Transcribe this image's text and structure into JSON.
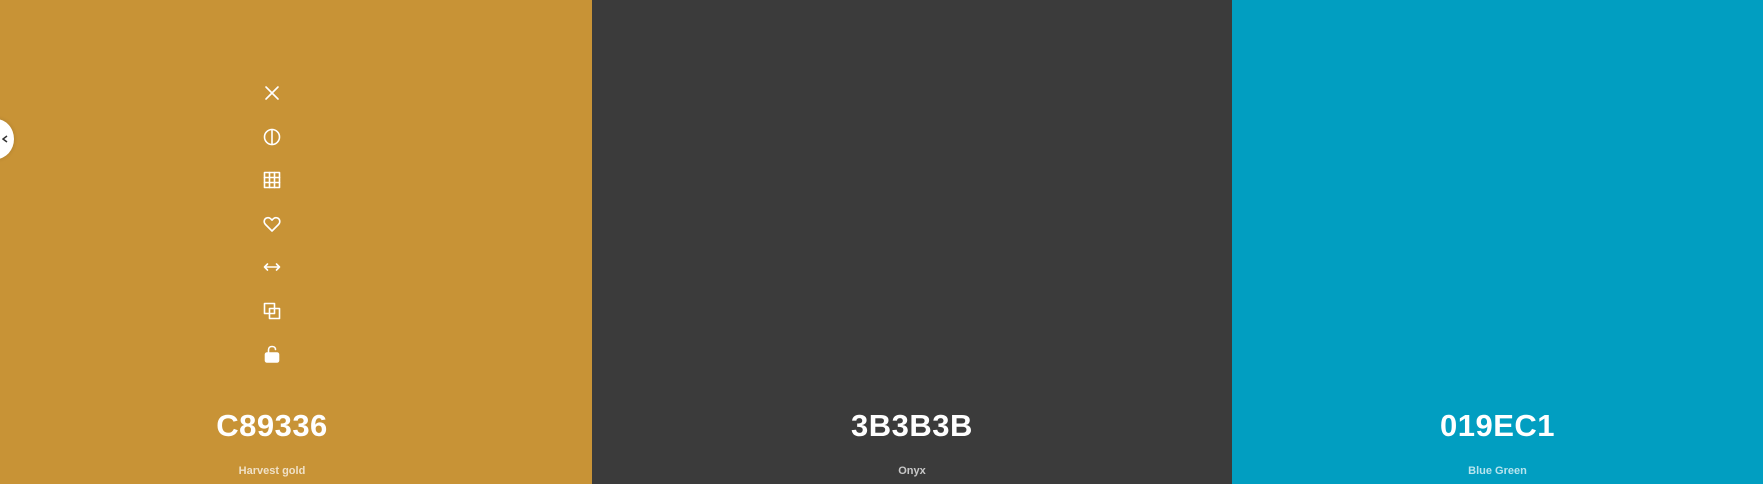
{
  "palette": {
    "colors": [
      {
        "hex": "C89336",
        "name": "Harvest gold",
        "bg": "#C89336"
      },
      {
        "hex": "3B3B3B",
        "name": "Onyx",
        "bg": "#3B3B3B"
      },
      {
        "hex": "019EC1",
        "name": "Blue Green",
        "bg": "#019EC1"
      }
    ]
  },
  "toolbar": {
    "icons": [
      "close-icon",
      "contrast-icon",
      "grid-icon",
      "heart-icon",
      "resize-arrows-icon",
      "copy-icon",
      "unlock-icon"
    ]
  },
  "edge_handle": {
    "icon": "chevron-left-icon"
  }
}
